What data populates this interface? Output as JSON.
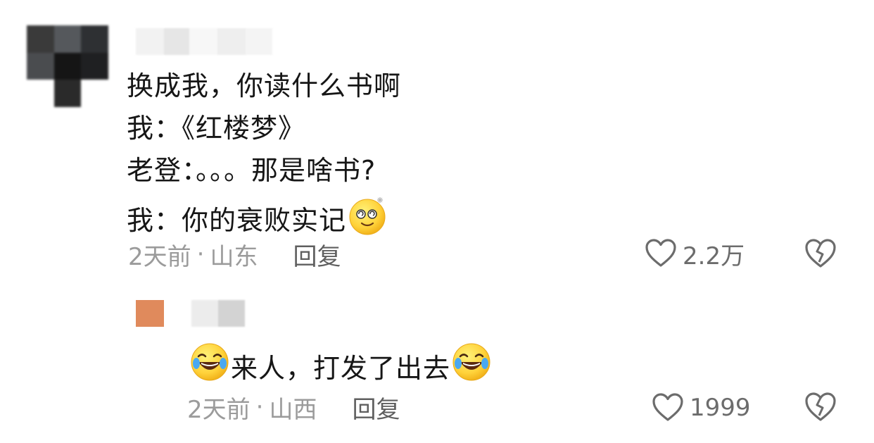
{
  "comments": [
    {
      "lines": [
        {
          "text": "换成我，你读什么书啊"
        },
        {
          "text": "我：《红楼梦》"
        },
        {
          "text": "老登：。。。那是啥书?"
        },
        {
          "text": "我：你的衰败实记",
          "emoji": "dizzy-face-emoji"
        }
      ],
      "meta": {
        "time": "2天前",
        "separator": "·",
        "location": "山东",
        "reply_label": "回复"
      },
      "likes": "2.2万"
    },
    {
      "reply": {
        "emoji_before": "rofl-emoji",
        "text": "来人，打发了出去",
        "emoji_after": "rofl-emoji"
      },
      "meta": {
        "time": "2天前",
        "separator": "·",
        "location": "山西",
        "reply_label": "回复"
      },
      "likes": "1999"
    }
  ],
  "icons": {
    "like": "heart-outline-icon",
    "dislike": "broken-heart-icon"
  },
  "colors": {
    "meta_text": "#9b9b9b",
    "reply_link": "#5f5f5f",
    "icon_stroke": "#6c6c6c",
    "reply_avatar": "#e08a5c"
  }
}
